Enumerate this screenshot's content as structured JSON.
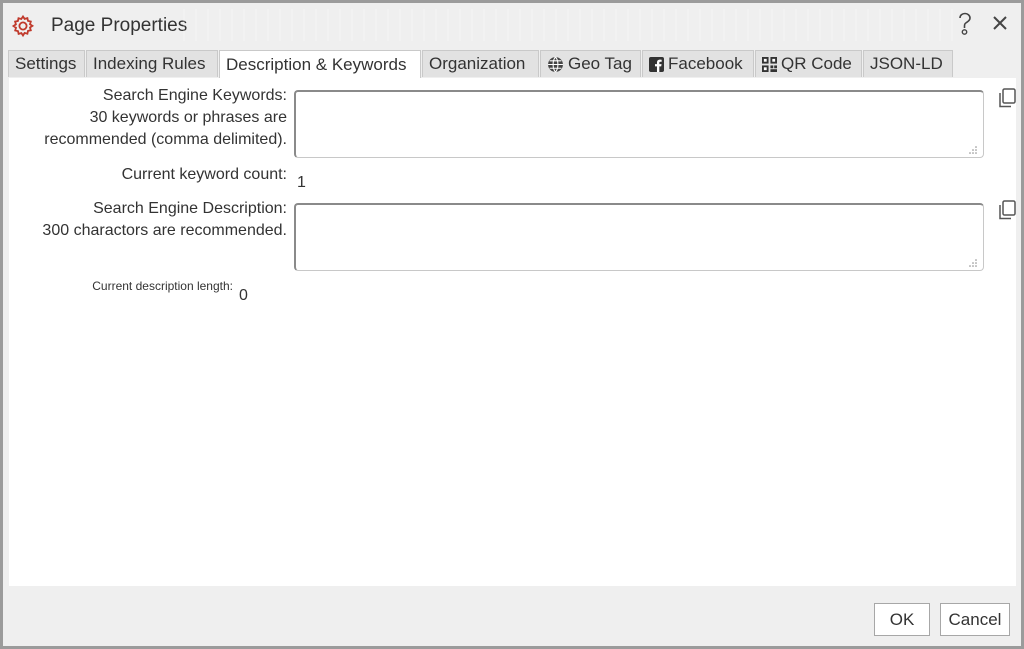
{
  "window": {
    "title": "Page Properties",
    "icons": {
      "app": "gear-icon",
      "help": "help-icon",
      "close": "close-icon"
    }
  },
  "tabs": [
    {
      "label": "Settings"
    },
    {
      "label": "Indexing Rules"
    },
    {
      "label": "Description & Keywords",
      "active": true
    },
    {
      "label": "Organization"
    },
    {
      "label": "Geo Tag",
      "icon": "globe-icon"
    },
    {
      "label": "Facebook",
      "icon": "facebook-icon"
    },
    {
      "label": "QR Code",
      "icon": "qr-code-icon"
    },
    {
      "label": "JSON-LD"
    }
  ],
  "form": {
    "keywords": {
      "label_line1": "Search Engine Keywords:",
      "label_line2": "30 keywords or phrases are",
      "label_line3": "recommended (comma delimited).",
      "value": "",
      "count_label": "Current keyword count:",
      "count_value": "1"
    },
    "description": {
      "label_line1": "Search Engine Description:",
      "label_line2": "300 charactors are recommended.",
      "value": "",
      "length_label": "Current description length:",
      "length_value": "0"
    }
  },
  "footer": {
    "ok_label": "OK",
    "cancel_label": "Cancel"
  },
  "colors": {
    "accent": "#c0392b",
    "dialog_bg": "#efefef",
    "content_bg": "#ffffff",
    "border": "#a7a7a7"
  }
}
